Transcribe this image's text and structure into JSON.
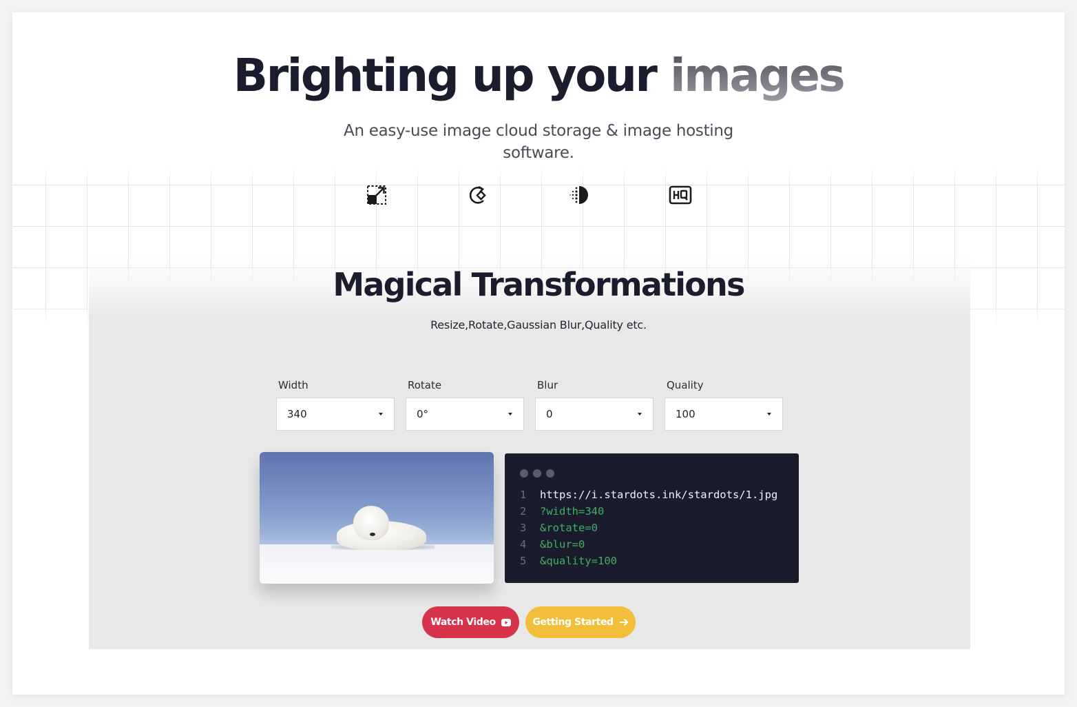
{
  "hero": {
    "title_main": "Brighting up your",
    "title_accent": "images",
    "subtitle": "An easy-use image cloud storage & image hosting software."
  },
  "feature_icons": [
    "resize-icon",
    "rotate-icon",
    "blur-icon",
    "hq-quality-icon"
  ],
  "section": {
    "title": "Magical Transformations",
    "subtitle": "Resize,Rotate,Gaussian Blur,Quality etc."
  },
  "controls": {
    "width": {
      "label": "Width",
      "value": "340"
    },
    "rotate": {
      "label": "Rotate",
      "value": "0°"
    },
    "blur": {
      "label": "Blur",
      "value": "0"
    },
    "quality": {
      "label": "Quality",
      "value": "100"
    }
  },
  "code": {
    "lines": [
      {
        "num": "1",
        "text": "https://i.stardots.ink/stardots/1.jpg"
      },
      {
        "num": "2",
        "text": "?width=340"
      },
      {
        "num": "3",
        "text": "&rotate=0"
      },
      {
        "num": "4",
        "text": "&blur=0"
      },
      {
        "num": "5",
        "text": "&quality=100"
      }
    ]
  },
  "buttons": {
    "watch_video": "Watch Video",
    "getting_started": "Getting Started"
  },
  "colors": {
    "watch_video_bg": "#d7334b",
    "getting_started_bg": "#f3bf3a",
    "code_bg": "#1a1c2b",
    "code_param": "#3fae6b"
  }
}
